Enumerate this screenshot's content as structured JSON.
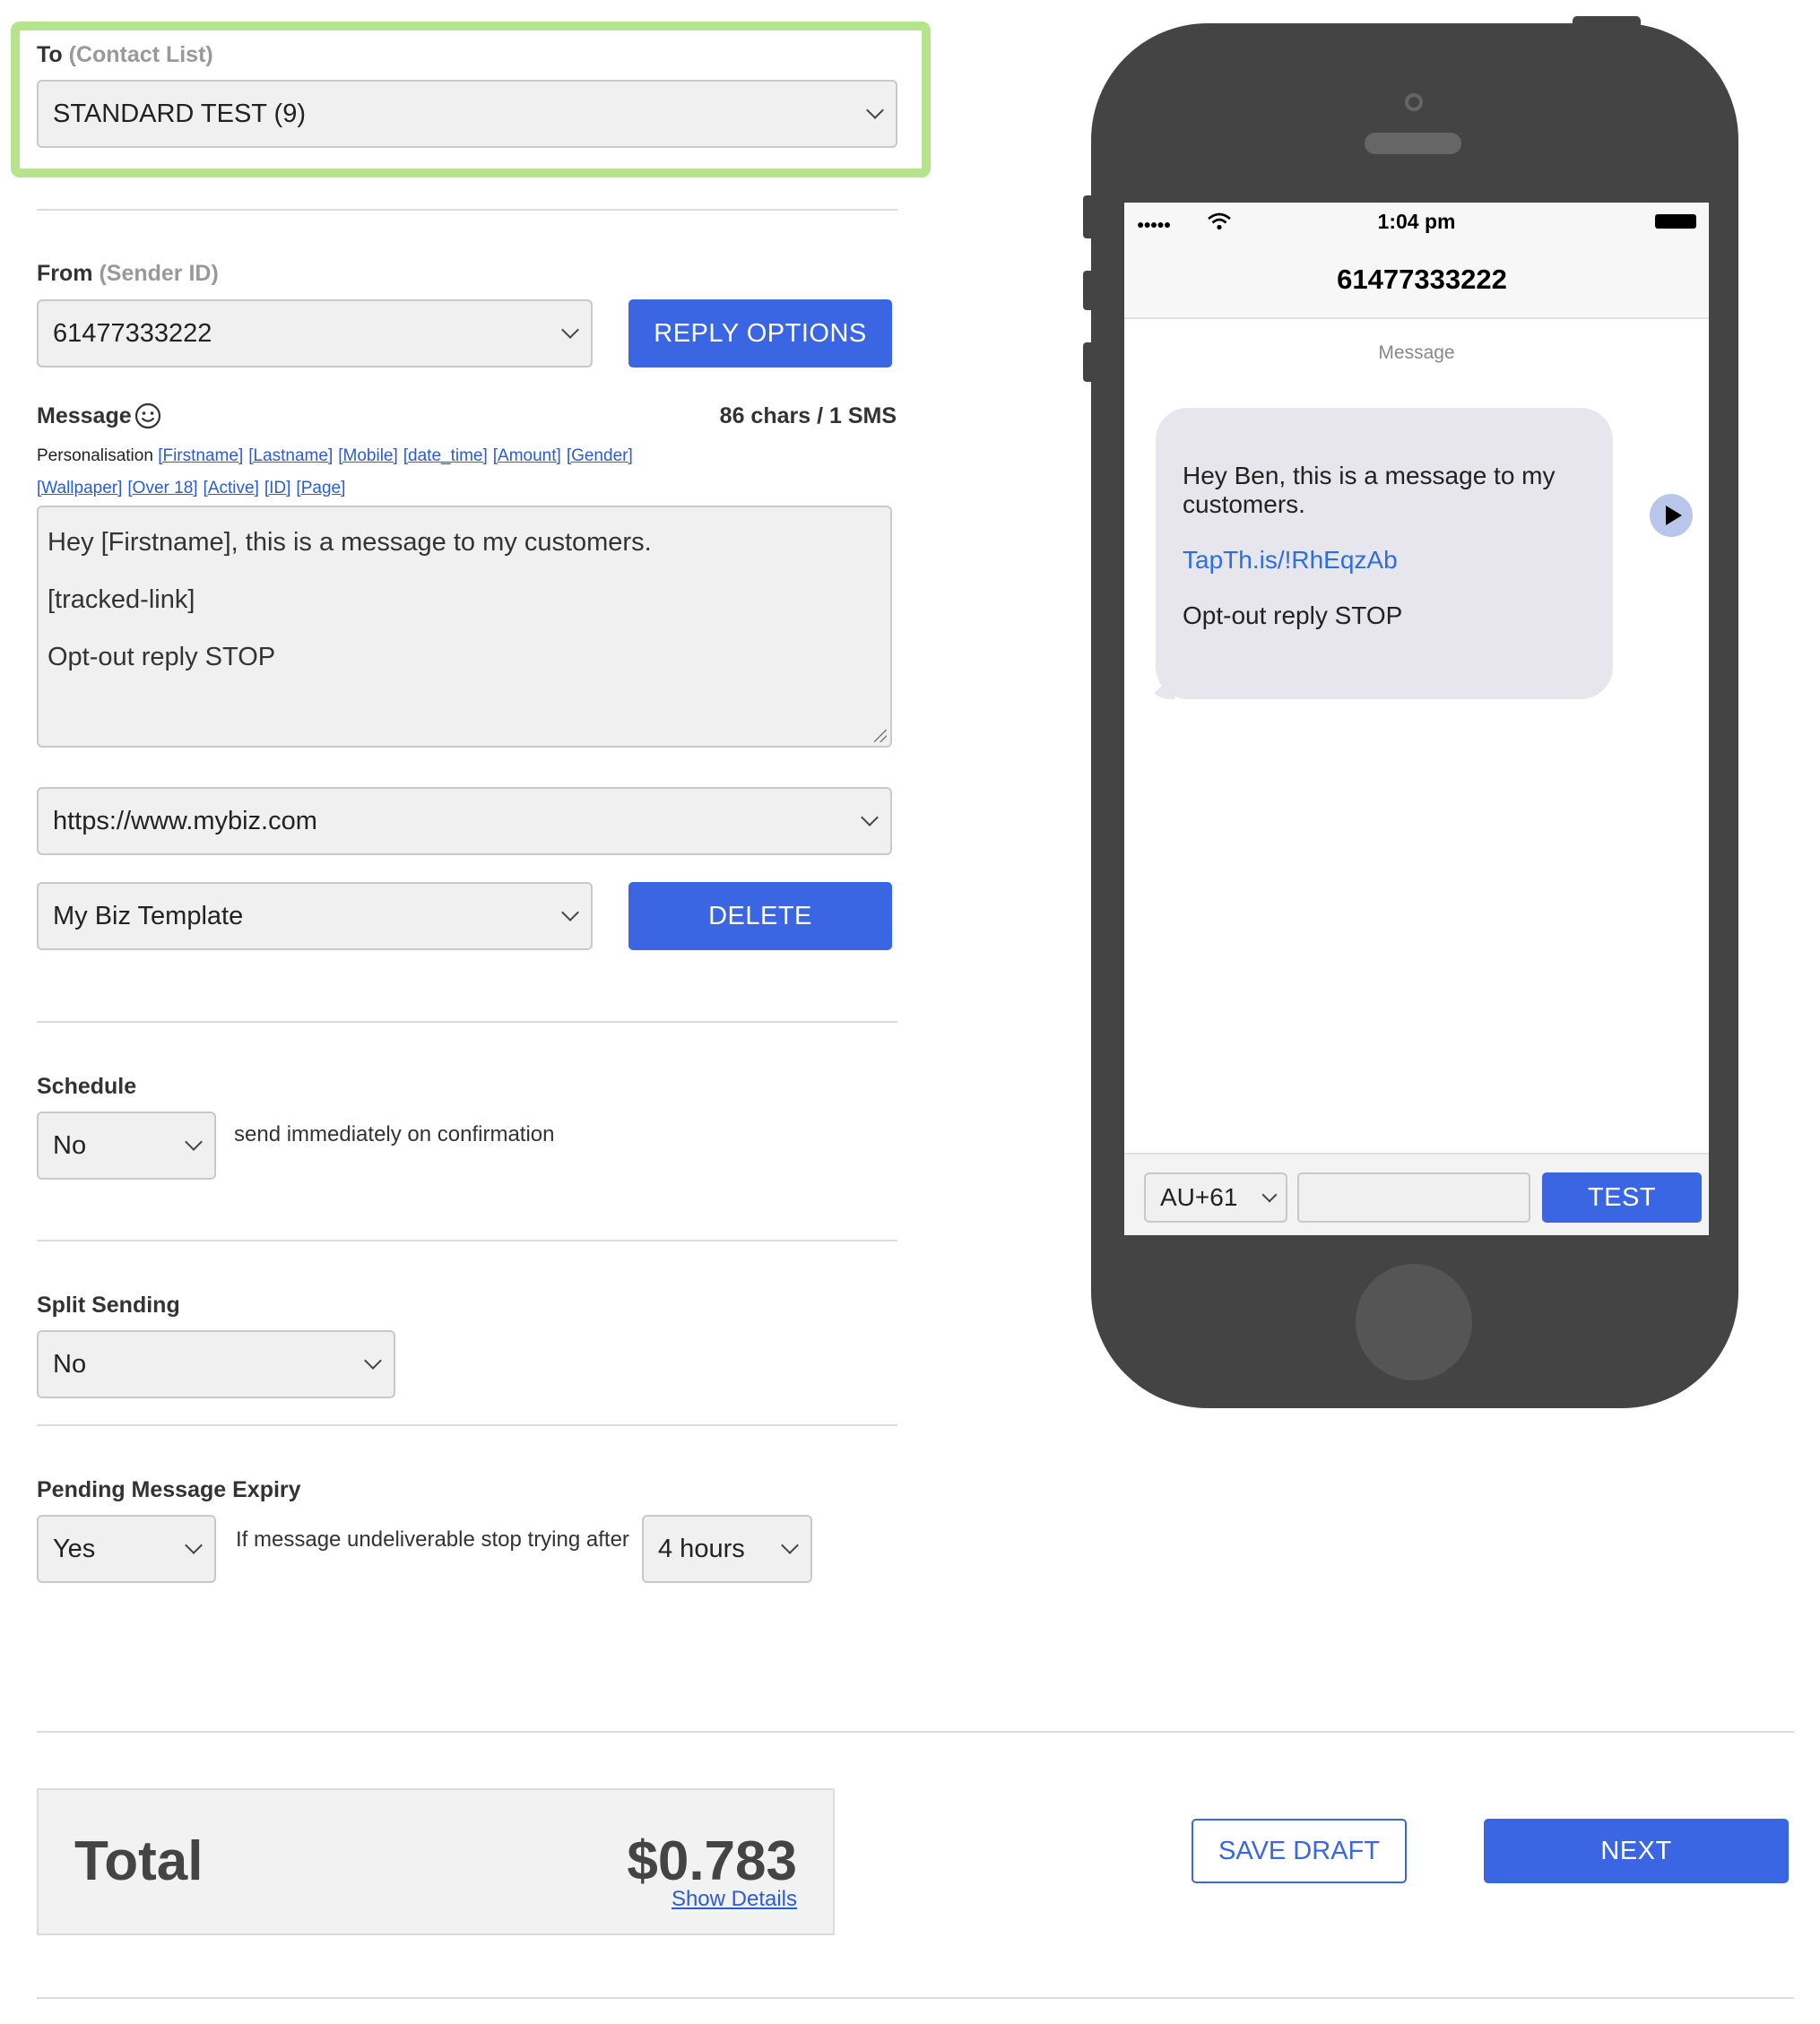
{
  "to": {
    "label": "To",
    "hint": "(Contact List)",
    "value": "STANDARD TEST (9)"
  },
  "from": {
    "label": "From",
    "hint": "(Sender ID)",
    "value": "61477333222",
    "reply_button": "REPLY OPTIONS"
  },
  "message": {
    "label": "Message",
    "counter": "86 chars / 1 SMS",
    "personalisation_label": "Personalisation",
    "tags_row1": [
      "[Firstname]",
      "[Lastname]",
      "[Mobile]",
      "[date_time]",
      "[Amount]",
      "[Gender]"
    ],
    "tags_row2": [
      "[Wallpaper]",
      "[Over 18]",
      "[Active]",
      "[ID]",
      "[Page]"
    ],
    "lines": [
      "Hey [Firstname], this is a message to my customers.",
      "[tracked-link]",
      "Opt-out reply STOP"
    ],
    "url": "https://www.mybiz.com",
    "template": "My Biz Template",
    "delete_button": "DELETE"
  },
  "schedule": {
    "label": "Schedule",
    "value": "No",
    "note": "send immediately on confirmation"
  },
  "split": {
    "label": "Split Sending",
    "value": "No"
  },
  "expiry": {
    "label": "Pending Message Expiry",
    "value": "Yes",
    "note": "If message undeliverable stop trying after",
    "duration": "4 hours"
  },
  "total": {
    "label": "Total",
    "amount": "$0.783",
    "details_link": "Show Details"
  },
  "actions": {
    "save_draft": "SAVE DRAFT",
    "next": "NEXT"
  },
  "phone": {
    "time": "1:04 pm",
    "contact": "61477333222",
    "thread_label": "Message",
    "bubble_line1": "Hey Ben, this is a message to my customers.",
    "bubble_link": "TapTh.is/!RhEqzAb",
    "bubble_line3": "Opt-out reply STOP",
    "country_code": "AU+61",
    "number_placeholder": "",
    "test_button": "TEST"
  },
  "colors": {
    "accent": "#3a66e4",
    "highlight": "#b5e48c",
    "phone_body": "#444444"
  }
}
